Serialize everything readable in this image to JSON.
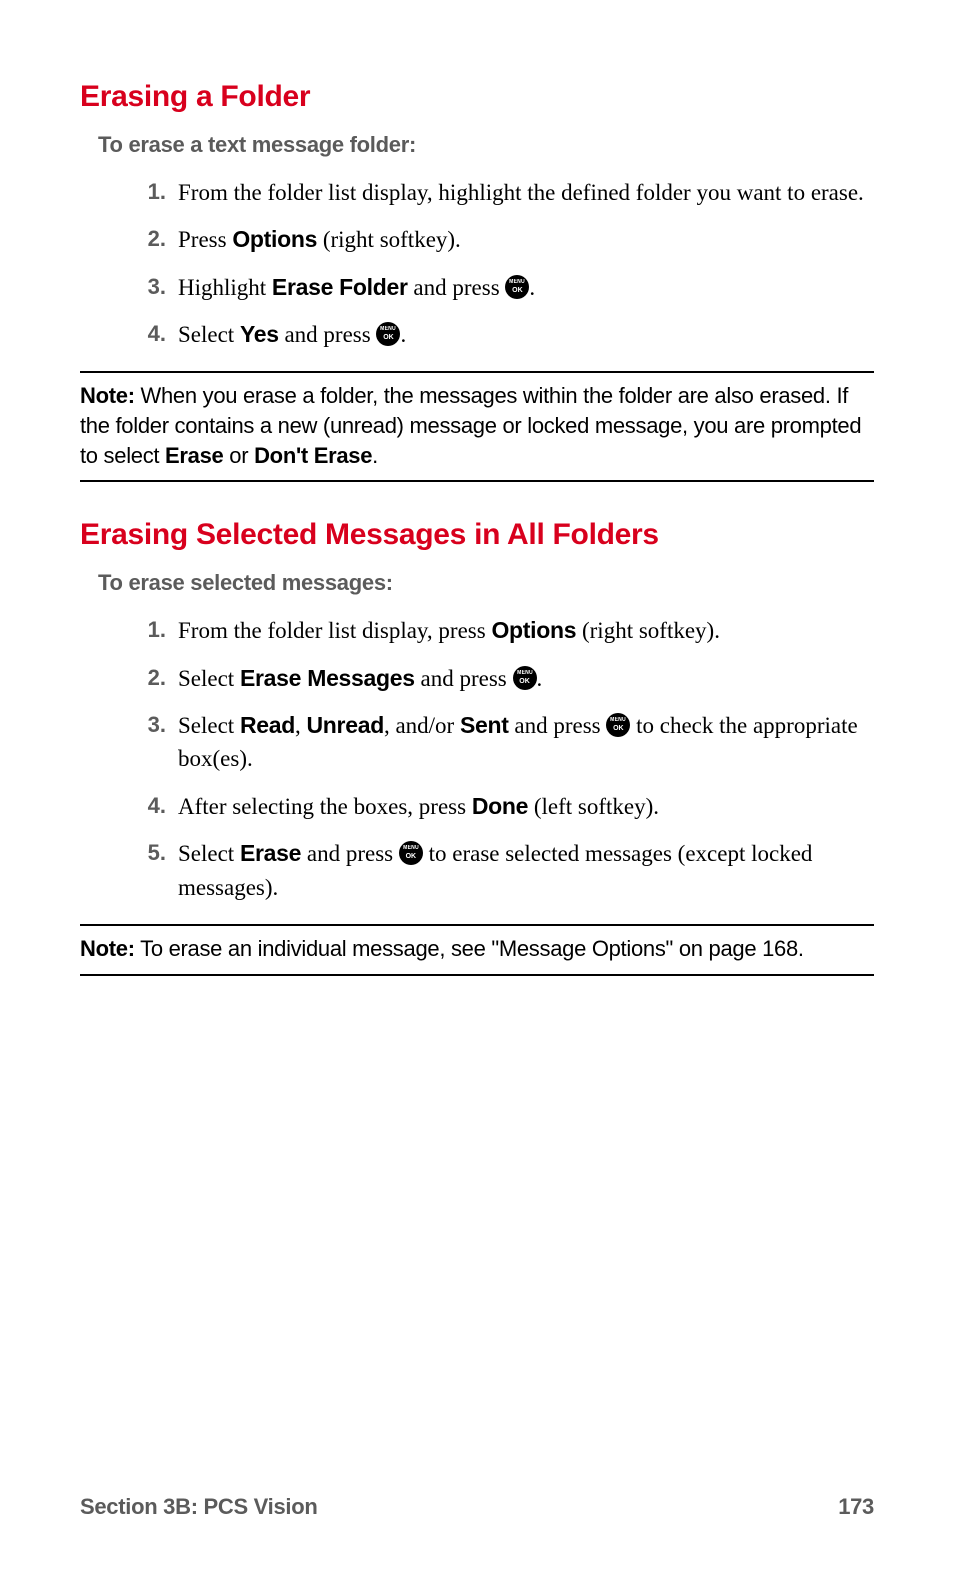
{
  "section1": {
    "heading": "Erasing a Folder",
    "intro": "To erase a text message folder:",
    "steps": {
      "s1": {
        "num": "1.",
        "t1": "From the folder list display, highlight the defined folder you want to erase."
      },
      "s2": {
        "num": "2.",
        "t1": "Press ",
        "b1": "Options",
        "t2": " (right softkey)."
      },
      "s3": {
        "num": "3.",
        "t1": "Highlight ",
        "b1": "Erase Folder",
        "t2": " and press ",
        "t3": "."
      },
      "s4": {
        "num": "4.",
        "t1": "Select ",
        "b1": "Yes",
        "t2": " and press ",
        "t3": "."
      }
    },
    "note": {
      "label": "Note:",
      "t1": " When you erase a folder, the messages within the folder are also erased. If the folder contains a new (unread) message or locked message, you are prompted to select ",
      "b1": "Erase",
      "t2": " or ",
      "b2": "Don't Erase",
      "t3": "."
    }
  },
  "section2": {
    "heading": "Erasing Selected Messages in All Folders",
    "intro": "To erase selected messages:",
    "steps": {
      "s1": {
        "num": "1.",
        "t1": "From the folder list display, press ",
        "b1": "Options",
        "t2": " (right softkey)."
      },
      "s2": {
        "num": "2.",
        "t1": "Select ",
        "b1": "Erase Messages",
        "t2": " and press ",
        "t3": "."
      },
      "s3": {
        "num": "3.",
        "t1": "Select ",
        "b1": "Read",
        "t2": ", ",
        "b2": "Unread",
        "t3": ", and/or ",
        "b3": "Sent",
        "t4": " and press ",
        "t5": " to check the appropriate box(es)."
      },
      "s4": {
        "num": "4.",
        "t1": "After selecting the boxes, press ",
        "b1": "Done",
        "t2": " (left softkey)."
      },
      "s5": {
        "num": "5.",
        "t1": "Select ",
        "b1": "Erase",
        "t2": " and press ",
        "t3": " to erase selected messages (except locked messages)."
      }
    },
    "note": {
      "label": "Note:",
      "t1": " To erase an individual message, see \"Message Options\" on page 168."
    }
  },
  "footer": {
    "left": "Section 3B: PCS Vision",
    "right": "173"
  }
}
